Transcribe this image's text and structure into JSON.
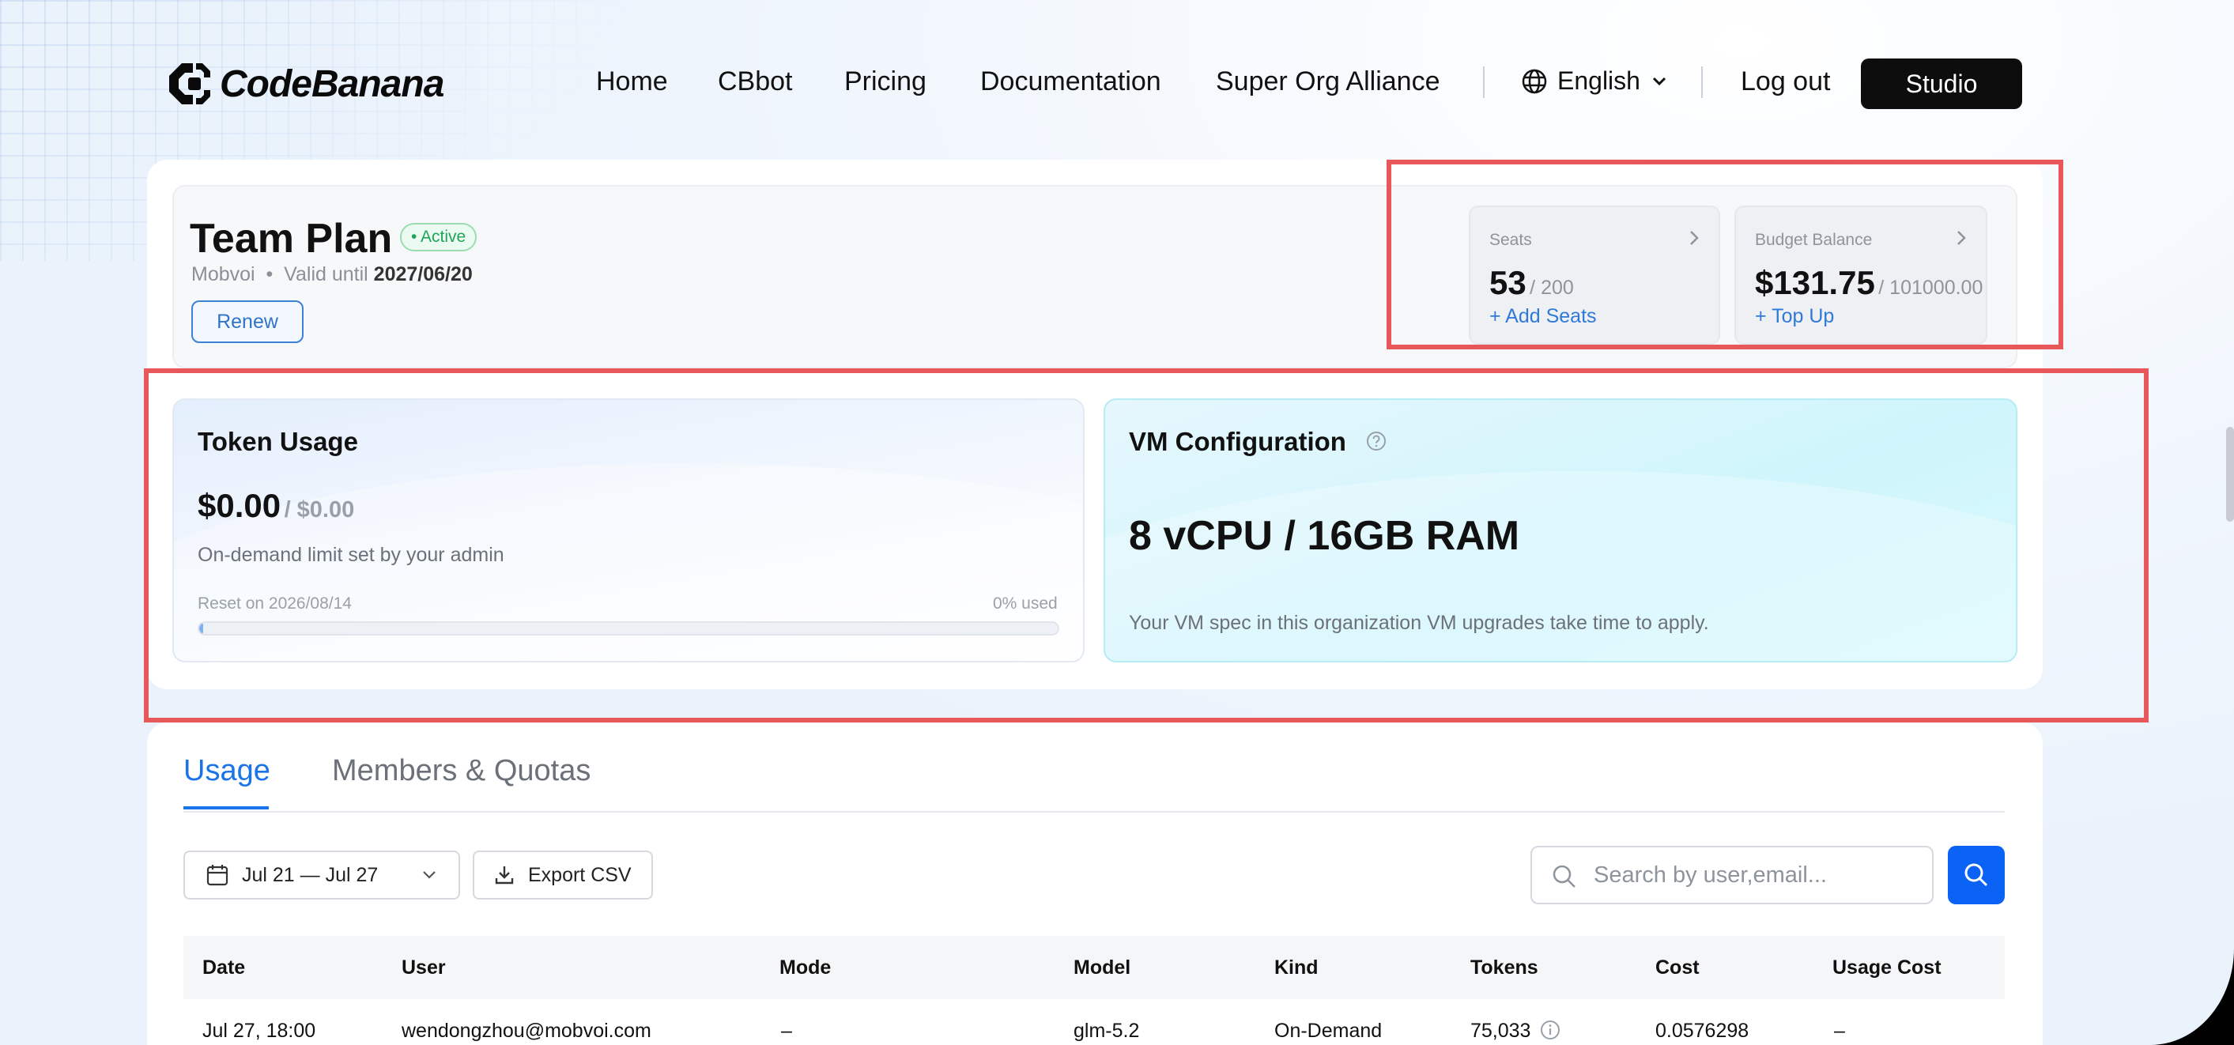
{
  "brand": {
    "name": "CodeBanana"
  },
  "nav": {
    "links": [
      "Home",
      "CBbot",
      "Pricing",
      "Documentation",
      "Super Org Alliance"
    ],
    "language": "English",
    "logout": "Log out",
    "studio": "Studio"
  },
  "plan": {
    "title": "Team Plan",
    "status": "• Active",
    "org": "Mobvoi",
    "separator": "•",
    "valid_prefix": "Valid until",
    "valid_date": "2027/06/20",
    "renew": "Renew"
  },
  "seats": {
    "label": "Seats",
    "value": "53",
    "total": "/ 200",
    "action": "+ Add Seats"
  },
  "budget": {
    "label": "Budget Balance",
    "value": "$131.75",
    "total": "/ 101000.00",
    "action": "+ Top Up"
  },
  "token_usage": {
    "title": "Token Usage",
    "amount": "$0.00",
    "limit": "/ $0.00",
    "note": "On-demand limit set by your admin",
    "reset": "Reset on 2026/08/14",
    "used": "0% used",
    "progress_fraction": 0.005
  },
  "vm": {
    "title": "VM Configuration",
    "spec": "8 vCPU / 16GB RAM",
    "note": "Your VM spec in this organization VM upgrades take time to apply."
  },
  "tabs": [
    "Usage",
    "Members & Quotas"
  ],
  "filters": {
    "date_range": "Jul 21 — Jul 27",
    "export": "Export CSV",
    "search_placeholder": "Search by user,email..."
  },
  "table": {
    "columns": [
      "Date",
      "User",
      "Mode",
      "Model",
      "Kind",
      "Tokens",
      "Cost",
      "Usage Cost"
    ],
    "rows": [
      [
        "Jul 27, 18:00",
        "wendongzhou@mobvoi.com",
        "–",
        "glm-5.2",
        "On-Demand",
        "75,033",
        "0.0576298",
        "–"
      ]
    ]
  },
  "colors": {
    "accent": "#1a73e8",
    "highlight": "#e8575a",
    "active_green": "#22a35a"
  }
}
